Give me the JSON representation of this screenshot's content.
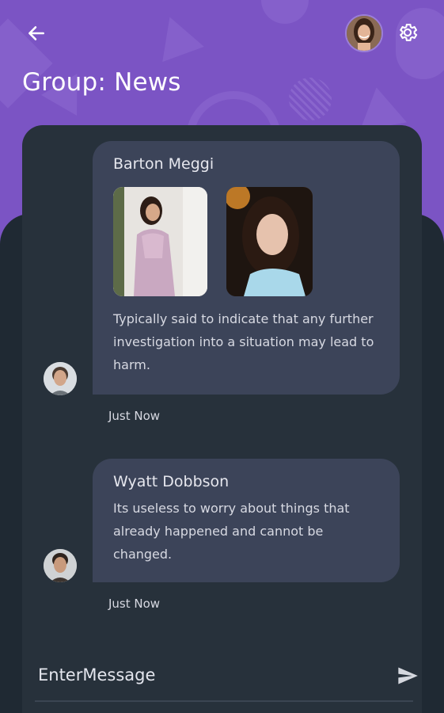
{
  "header": {
    "title": "Group: News",
    "back_icon": "arrow-left-icon",
    "settings_icon": "gear-icon"
  },
  "messages": [
    {
      "sender": "Barton Meggi",
      "text": "Typically said to indicate that any further investigation into a situation may lead to harm.",
      "time": "Just Now",
      "attachments": 2
    },
    {
      "sender": "Wyatt Dobbson",
      "text": "Its useless to worry about things that already happened and cannot be changed.",
      "time": "Just Now"
    }
  ],
  "composer": {
    "placeholder": "EnterMessage",
    "send_icon": "send-icon"
  },
  "colors": {
    "header_bg": "#7b54c4",
    "sheet_bg": "#27313b",
    "bubble_bg": "#3c4459",
    "text": "#dfe1ea"
  }
}
